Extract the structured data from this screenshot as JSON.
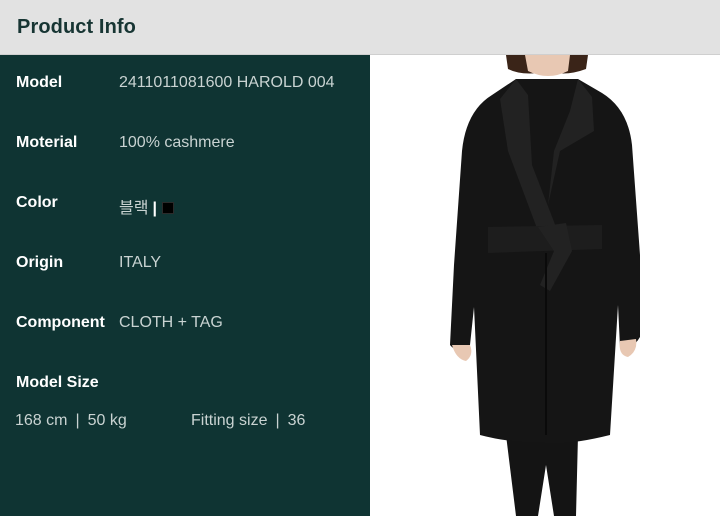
{
  "header": {
    "title": "Product Info"
  },
  "info": {
    "model": {
      "label": "Model",
      "value": "2411011081600 HAROLD 004"
    },
    "material": {
      "label": "Moterial",
      "value": "100% cashmere"
    },
    "color": {
      "label": "Color",
      "value": "블랙",
      "separator": "|",
      "swatch_hex": "#000000"
    },
    "origin": {
      "label": "Origin",
      "value": "ITALY"
    },
    "component": {
      "label": "Component",
      "value": "CLOTH + TAG"
    }
  },
  "model_size": {
    "label": "Model Size",
    "height": "168 cm",
    "weight": "50 kg",
    "fitting_label": "Fitting size",
    "fitting_value": "36",
    "separator": "|"
  },
  "colors": {
    "header_bg": "#e2e2e2",
    "panel_bg": "#0f3433",
    "coat": "#151515"
  }
}
